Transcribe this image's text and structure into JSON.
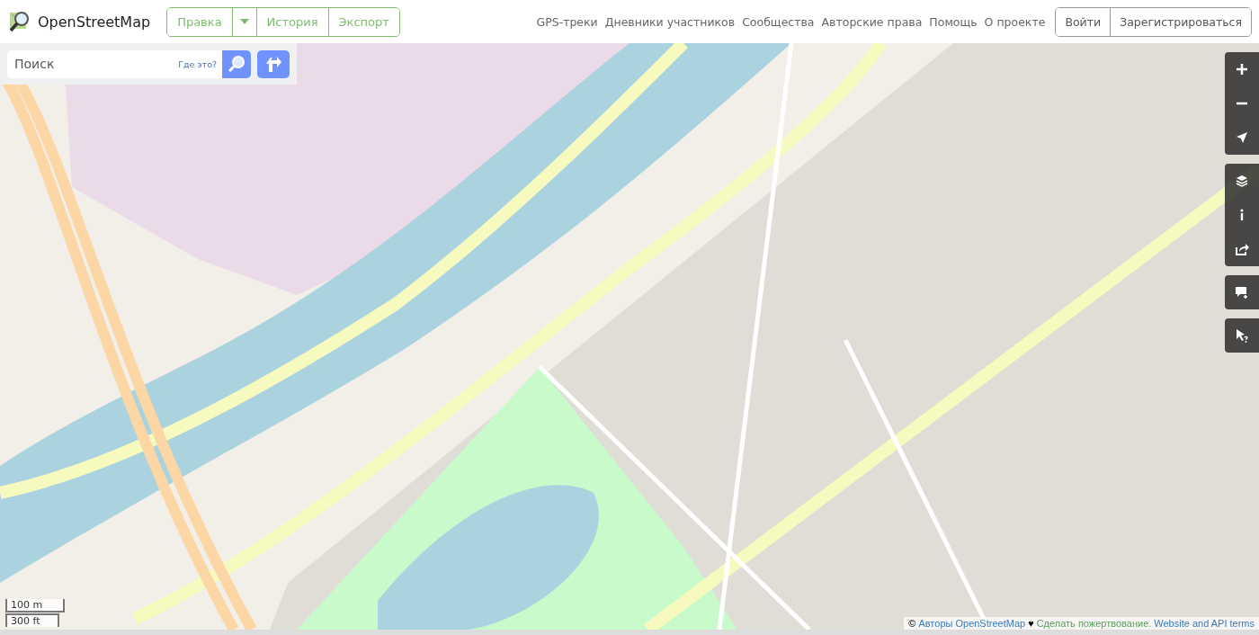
{
  "header": {
    "logo": "OpenStreetMap",
    "edit_tabs": [
      {
        "label": "Правка",
        "kind": "button"
      },
      {
        "kind": "dropdown"
      },
      {
        "label": "История",
        "kind": "button"
      },
      {
        "label": "Экспорт",
        "kind": "button"
      }
    ],
    "nav_links": [
      "GPS-треки",
      "Дневники участников",
      "Сообщества",
      "Авторские права",
      "Помощь",
      "О проекте"
    ],
    "auth_buttons": [
      "Войти",
      "Зарегистрироваться"
    ]
  },
  "search": {
    "placeholder": "Поиск",
    "where_link": "Где это?"
  },
  "scale": [
    "100 m",
    "300 ft"
  ],
  "attribution": {
    "prefix": "©",
    "authors_link": "Авторы OpenStreetMap",
    "heart": "♥",
    "donate_link": "Сделать пожертвование.",
    "terms_link": "Website and API terms"
  }
}
